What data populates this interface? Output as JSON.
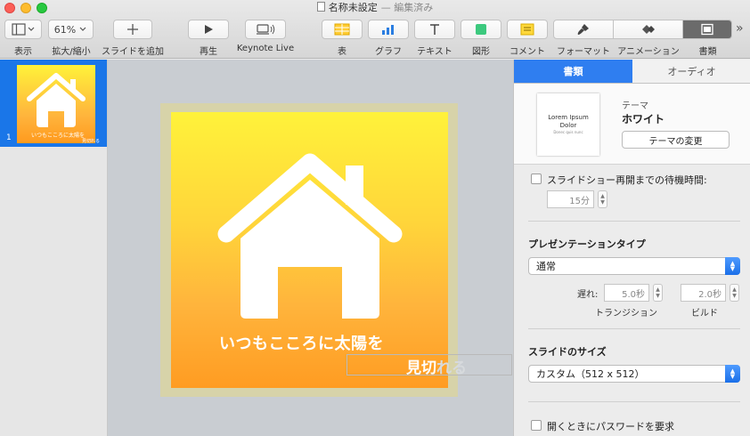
{
  "window": {
    "title": "名称未設定",
    "status": "— 編集済み"
  },
  "toolbar": {
    "view_label": "表示",
    "zoom_value": "61%",
    "zoom_label": "拡大/縮小",
    "add_slide_label": "スライドを追加",
    "play_label": "再生",
    "keynote_live_label": "Keynote Live",
    "table_label": "表",
    "chart_label": "グラフ",
    "text_label": "テキスト",
    "shape_label": "図形",
    "comment_label": "コメント",
    "format_label": "フォーマット",
    "animate_label": "アニメーション",
    "document_label": "書類",
    "more_label": "»"
  },
  "navigator": {
    "slide_number": "1",
    "thumb_title": "いつもこころに太陽を",
    "thumb_overflow": "見切れる"
  },
  "slide": {
    "title": "いつもこころに太陽を",
    "overflow_text_visible": "見切",
    "overflow_text_hidden": "れる"
  },
  "inspector": {
    "tabs": [
      "書類",
      "オーディオ"
    ],
    "theme_caption": "テーマ",
    "theme_name": "ホワイト",
    "theme_preview_line1": "Lorem Ipsum",
    "theme_preview_line2": "Dolor",
    "theme_preview_line3": "Donec quis nunc",
    "change_theme_button": "テーマの変更",
    "loop_label": "スライドショー再開までの待機時間:",
    "loop_value": "15分",
    "presentation_type_heading": "プレゼンテーションタイプ",
    "presentation_type_value": "通常",
    "delay_label": "遅れ:",
    "transition_value": "5.0秒",
    "transition_label": "トランジション",
    "build_value": "2.0秒",
    "build_label": "ビルド",
    "slide_size_heading": "スライドのサイズ",
    "slide_size_value": "カスタム（512 x 512）",
    "password_label": "開くときにパスワードを要求"
  },
  "colors": {
    "accent": "#2f7ef0",
    "selection": "#1a76e8",
    "slide_top": "#fff23a",
    "slide_bottom": "#ff9c22"
  }
}
